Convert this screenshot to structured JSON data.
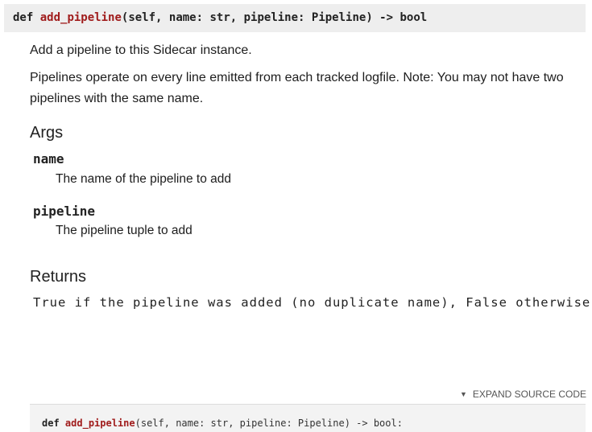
{
  "signature": {
    "keyword": "def",
    "function_name": "add_pipeline",
    "params": "(self, name: str, pipeline: Pipeline) -> bool"
  },
  "docstring": {
    "summary": "Add a pipeline to this Sidecar instance.",
    "description": "Pipelines operate on every line emitted from each tracked logfile. Note: You may not have two pipelines with the same name."
  },
  "args": {
    "heading": "Args",
    "items": [
      {
        "name": "name",
        "description": "The name of the pipeline to add"
      },
      {
        "name": "pipeline",
        "description": "The pipeline tuple to add"
      }
    ]
  },
  "returns": {
    "heading": "Returns",
    "text": "True if the pipeline was added (no duplicate name), False otherwise"
  },
  "source": {
    "expand_label": "EXPAND SOURCE CODE",
    "expand_icon": "triangle-down-icon",
    "keyword": "def",
    "function_name": "add_pipeline",
    "params": "(self, name: str, pipeline: Pipeline) -> bool:"
  }
}
